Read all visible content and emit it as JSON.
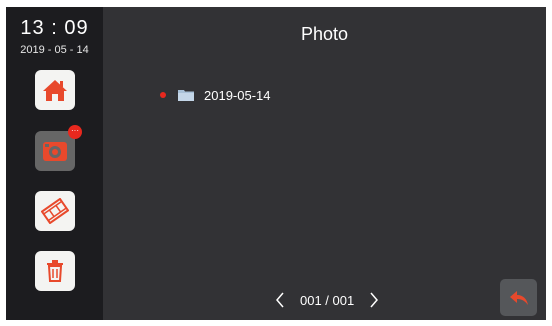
{
  "status": {
    "time": "13 : 09",
    "date": "2019 - 05 - 14"
  },
  "header": {
    "title": "Photo"
  },
  "sidebar": {
    "items": [
      {
        "name": "home",
        "icon": "home-icon"
      },
      {
        "name": "photo",
        "icon": "camera-icon",
        "badge": "···"
      },
      {
        "name": "video",
        "icon": "film-icon"
      },
      {
        "name": "delete",
        "icon": "trash-icon"
      }
    ]
  },
  "folders": [
    {
      "name": "2019-05-14",
      "unread": true
    }
  ],
  "pagination": {
    "label": "001 / 001"
  },
  "colors": {
    "background": "#323235",
    "sidebar": "#1c1c1f",
    "accent": "#e8492c",
    "unread_dot": "#e8281e"
  }
}
